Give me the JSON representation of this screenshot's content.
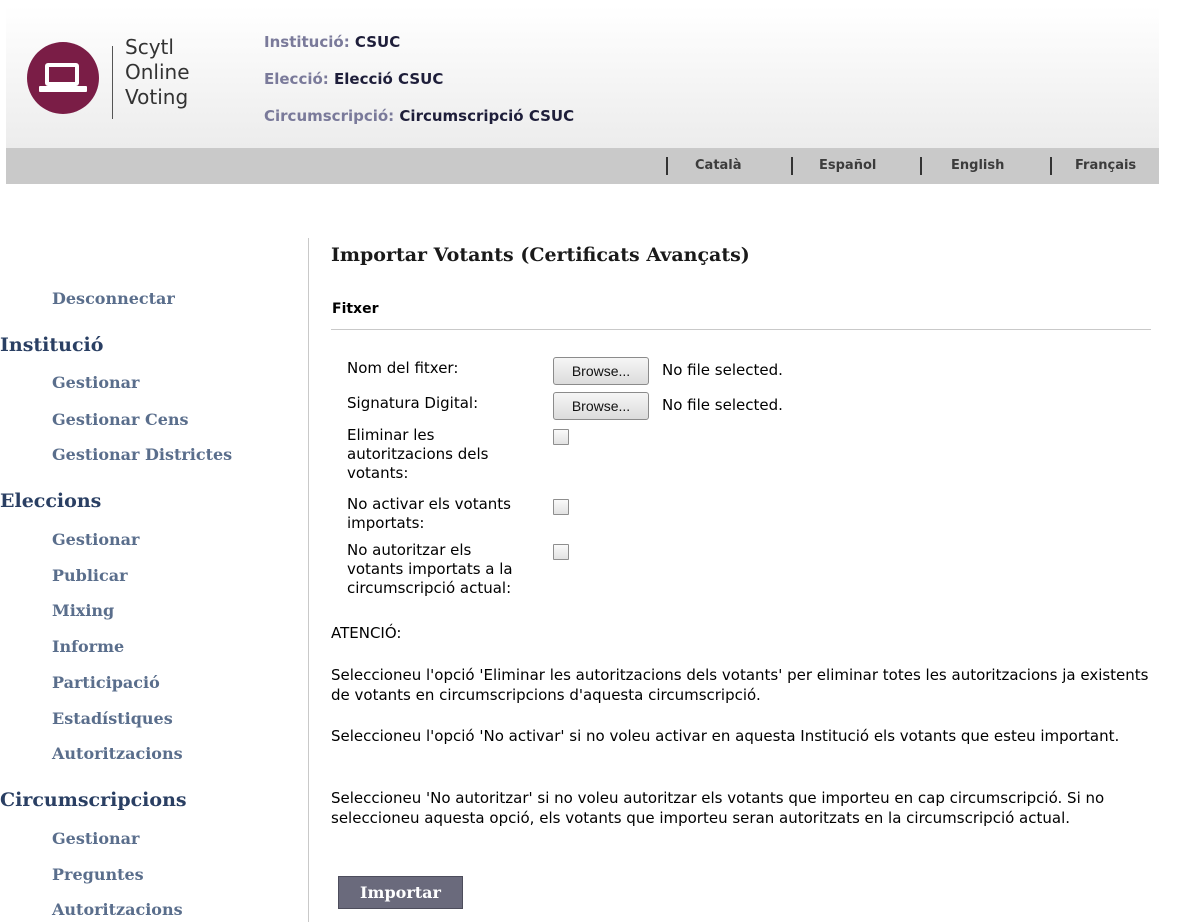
{
  "brand": {
    "line1": "Scytl",
    "line2": "Online",
    "line3": "Voting",
    "color": "#7a1d46"
  },
  "header": {
    "institucio_label": "Institució:",
    "institucio_value": "CSUC",
    "eleccio_label": "Elecció:",
    "eleccio_value": "Elecció CSUC",
    "circ_label": "Circumscripció:",
    "circ_value": "Circumscripció CSUC"
  },
  "languages": [
    "Català",
    "Español",
    "English",
    "Français"
  ],
  "sidebar": {
    "disconnect": "Desconnectar",
    "institucio": {
      "title": "Institució",
      "items": [
        "Gestionar",
        "Gestionar Cens",
        "Gestionar Districtes"
      ]
    },
    "eleccions": {
      "title": "Eleccions",
      "items": [
        "Gestionar",
        "Publicar",
        "Mixing",
        "Informe",
        "Participació",
        "Estadístiques",
        "Autoritzacions"
      ]
    },
    "circumscripcions": {
      "title": "Circumscripcions",
      "items": [
        "Gestionar",
        "Preguntes",
        "Autoritzacions"
      ]
    }
  },
  "main": {
    "title": "Importar Votants (Certificats Avançats)",
    "section": "Fitxer",
    "fields": {
      "file_label": "Nom del fitxer:",
      "signature_label": "Signatura Digital:",
      "browse_label": "Browse...",
      "no_file": "No file selected.",
      "delete_auth": [
        "Eliminar les",
        "autoritzacions dels",
        "votants:"
      ],
      "no_activate": [
        "No activar els votants",
        "importats:"
      ],
      "no_authorize": [
        "No autoritzar els",
        "votants importats a la",
        "circumscripció actual:"
      ]
    },
    "attention": "ATENCIÓ:",
    "paragraphs": [
      "Seleccioneu l'opció 'Eliminar les autoritzacions dels votants' per eliminar totes les autoritzacions ja existents de votants en circumscripcions d'aquesta circumscripció.",
      "Seleccioneu l'opció 'No activar' si no voleu activar en aquesta Institució els votants que esteu important.",
      "Seleccioneu 'No autoritzar' si no voleu autoritzar els votants que importeu en cap circumscripció. Si no seleccioneu aquesta opció, els votants que importeu seran autoritzats en la circumscripció actual."
    ],
    "import_button": "Importar"
  }
}
